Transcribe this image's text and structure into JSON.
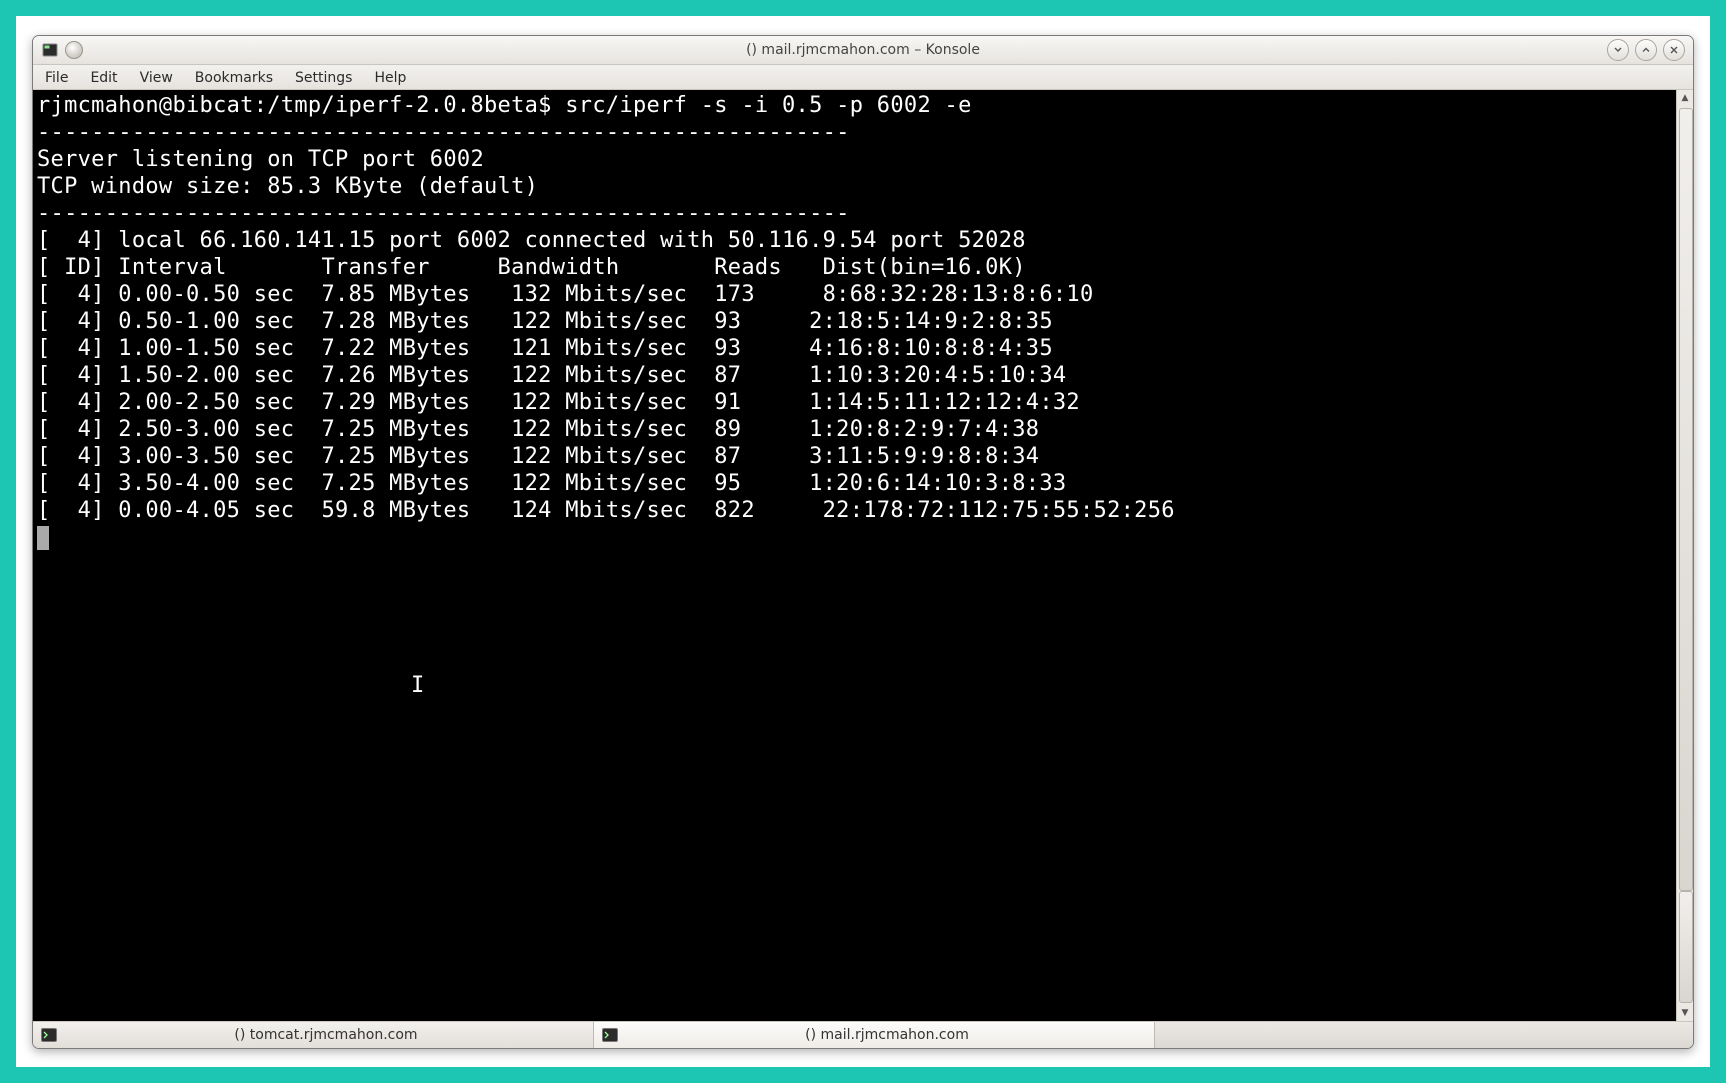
{
  "window": {
    "title": "() mail.rjmcmahon.com – Konsole"
  },
  "menubar": {
    "items": [
      "File",
      "Edit",
      "View",
      "Bookmarks",
      "Settings",
      "Help"
    ]
  },
  "terminal": {
    "prompt": "rjmcmahon@bibcat:/tmp/iperf-2.0.8beta$ ",
    "command": "src/iperf -s -i 0.5 -p 6002 -e",
    "divider": "------------------------------------------------------------",
    "listen_line": "Server listening on TCP port 6002",
    "window_line": "TCP window size: 85.3 KByte (default)",
    "conn_line": "[  4] local 66.160.141.15 port 6002 connected with 50.116.9.54 port 52028",
    "header_line": "[ ID] Interval       Transfer     Bandwidth       Reads   Dist(bin=16.0K)",
    "rows": [
      "[  4] 0.00-0.50 sec  7.85 MBytes   132 Mbits/sec  173     8:68:32:28:13:8:6:10",
      "[  4] 0.50-1.00 sec  7.28 MBytes   122 Mbits/sec  93     2:18:5:14:9:2:8:35",
      "[  4] 1.00-1.50 sec  7.22 MBytes   121 Mbits/sec  93     4:16:8:10:8:8:4:35",
      "[  4] 1.50-2.00 sec  7.26 MBytes   122 Mbits/sec  87     1:10:3:20:4:5:10:34",
      "[  4] 2.00-2.50 sec  7.29 MBytes   122 Mbits/sec  91     1:14:5:11:12:12:4:32",
      "[  4] 2.50-3.00 sec  7.25 MBytes   122 Mbits/sec  89     1:20:8:2:9:7:4:38",
      "[  4] 3.00-3.50 sec  7.25 MBytes   122 Mbits/sec  87     3:11:5:9:9:8:8:34",
      "[  4] 3.50-4.00 sec  7.25 MBytes   122 Mbits/sec  95     1:20:6:14:10:3:8:33",
      "[  4] 0.00-4.05 sec  59.8 MBytes   124 Mbits/sec  822     22:178:72:112:75:55:52:256"
    ]
  },
  "tabs": [
    {
      "label": "() tomcat.rjmcmahon.com",
      "active": false
    },
    {
      "label": "() mail.rjmcmahon.com",
      "active": true
    }
  ]
}
